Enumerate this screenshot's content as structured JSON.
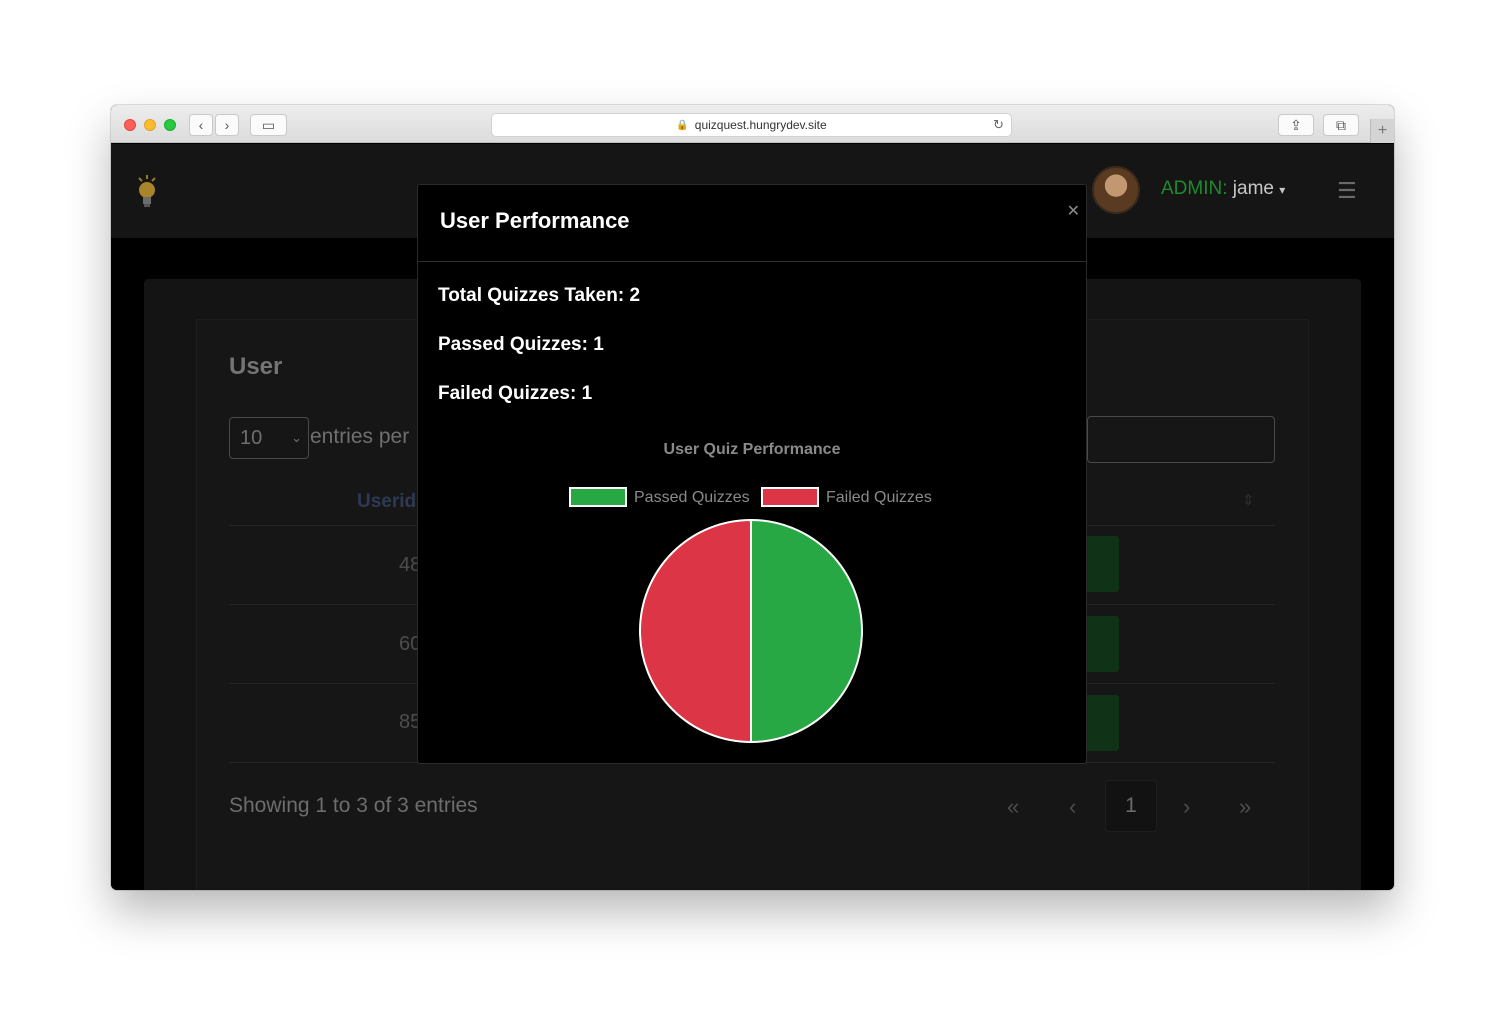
{
  "browser": {
    "url": "quizquest.hungrydev.site"
  },
  "navbar": {
    "role": "ADMIN:",
    "username": "jame"
  },
  "page": {
    "title": "User",
    "entries_value": "10",
    "entries_label": "entries per",
    "column_header": "Userid",
    "rows": [
      {
        "id": "48"
      },
      {
        "id": "60"
      },
      {
        "id": "85"
      }
    ],
    "showing": "Showing 1 to 3 of 3 entries",
    "pagination": {
      "first": "«",
      "prev": "‹",
      "current": "1",
      "next": "›",
      "last": "»"
    }
  },
  "modal": {
    "title": "User Performance",
    "total": "Total Quizzes Taken: 2",
    "passed": "Passed Quizzes: 1",
    "failed": "Failed Quizzes: 1"
  },
  "colors": {
    "passed": "#28a745",
    "failed": "#dc3545"
  },
  "chart_data": {
    "type": "pie",
    "title": "User Quiz Performance",
    "categories": [
      "Passed Quizzes",
      "Failed Quizzes"
    ],
    "values": [
      1,
      1
    ],
    "colors": [
      "#28a745",
      "#dc3545"
    ],
    "legend": "top"
  }
}
